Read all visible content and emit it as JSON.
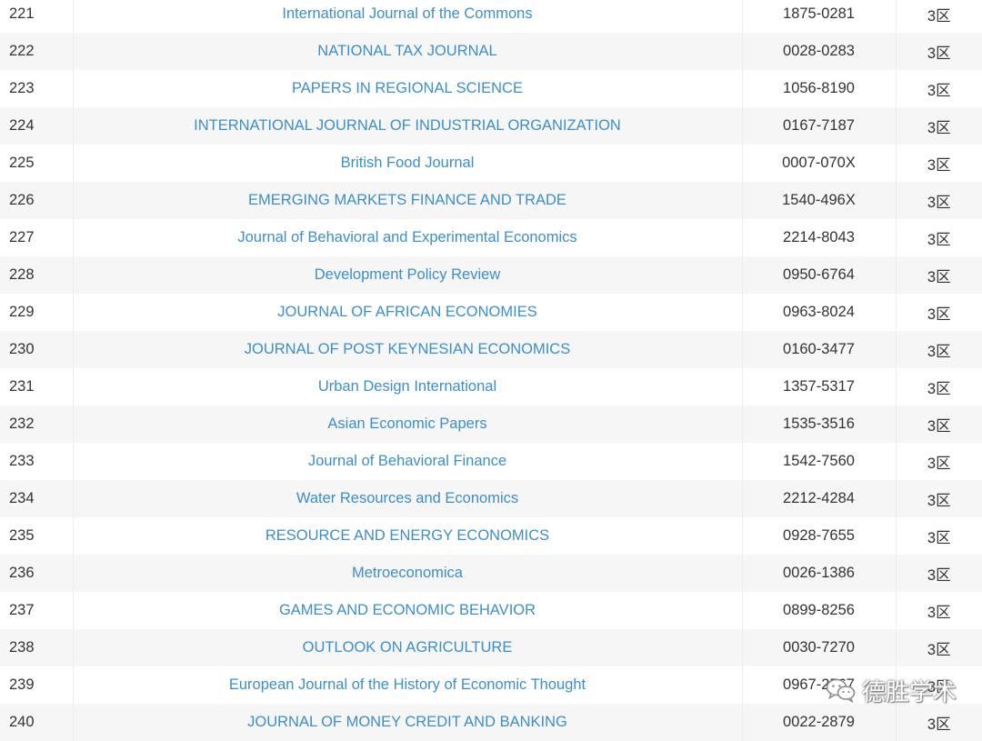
{
  "colors": {
    "link": "#3b8fc7",
    "text": "#333333",
    "row_alt": "#f6f6f6"
  },
  "rows": [
    {
      "rank": "221",
      "name": "International Journal of the Commons",
      "issn": "1875-0281",
      "zone": "3区"
    },
    {
      "rank": "222",
      "name": "NATIONAL TAX JOURNAL",
      "issn": "0028-0283",
      "zone": "3区"
    },
    {
      "rank": "223",
      "name": "PAPERS IN REGIONAL SCIENCE",
      "issn": "1056-8190",
      "zone": "3区"
    },
    {
      "rank": "224",
      "name": "INTERNATIONAL JOURNAL OF INDUSTRIAL ORGANIZATION",
      "issn": "0167-7187",
      "zone": "3区"
    },
    {
      "rank": "225",
      "name": "British Food Journal",
      "issn": "0007-070X",
      "zone": "3区"
    },
    {
      "rank": "226",
      "name": "EMERGING MARKETS FINANCE AND TRADE",
      "issn": "1540-496X",
      "zone": "3区"
    },
    {
      "rank": "227",
      "name": "Journal of Behavioral and Experimental Economics",
      "issn": "2214-8043",
      "zone": "3区"
    },
    {
      "rank": "228",
      "name": "Development Policy Review",
      "issn": "0950-6764",
      "zone": "3区"
    },
    {
      "rank": "229",
      "name": "JOURNAL OF AFRICAN ECONOMIES",
      "issn": "0963-8024",
      "zone": "3区"
    },
    {
      "rank": "230",
      "name": "JOURNAL OF POST KEYNESIAN ECONOMICS",
      "issn": "0160-3477",
      "zone": "3区"
    },
    {
      "rank": "231",
      "name": "Urban Design International",
      "issn": "1357-5317",
      "zone": "3区"
    },
    {
      "rank": "232",
      "name": "Asian Economic Papers",
      "issn": "1535-3516",
      "zone": "3区"
    },
    {
      "rank": "233",
      "name": "Journal of Behavioral Finance",
      "issn": "1542-7560",
      "zone": "3区"
    },
    {
      "rank": "234",
      "name": "Water Resources and Economics",
      "issn": "2212-4284",
      "zone": "3区"
    },
    {
      "rank": "235",
      "name": "RESOURCE AND ENERGY ECONOMICS",
      "issn": "0928-7655",
      "zone": "3区"
    },
    {
      "rank": "236",
      "name": "Metroeconomica",
      "issn": "0026-1386",
      "zone": "3区"
    },
    {
      "rank": "237",
      "name": "GAMES AND ECONOMIC BEHAVIOR",
      "issn": "0899-8256",
      "zone": "3区"
    },
    {
      "rank": "238",
      "name": "OUTLOOK ON AGRICULTURE",
      "issn": "0030-7270",
      "zone": "3区"
    },
    {
      "rank": "239",
      "name": "European Journal of the History of Economic Thought",
      "issn": "0967-2567",
      "zone": "3区"
    },
    {
      "rank": "240",
      "name": "JOURNAL OF MONEY CREDIT AND BANKING",
      "issn": "0022-2879",
      "zone": "3区"
    }
  ],
  "watermark": {
    "icon": "wechat-icon",
    "text": "德胜学术"
  }
}
